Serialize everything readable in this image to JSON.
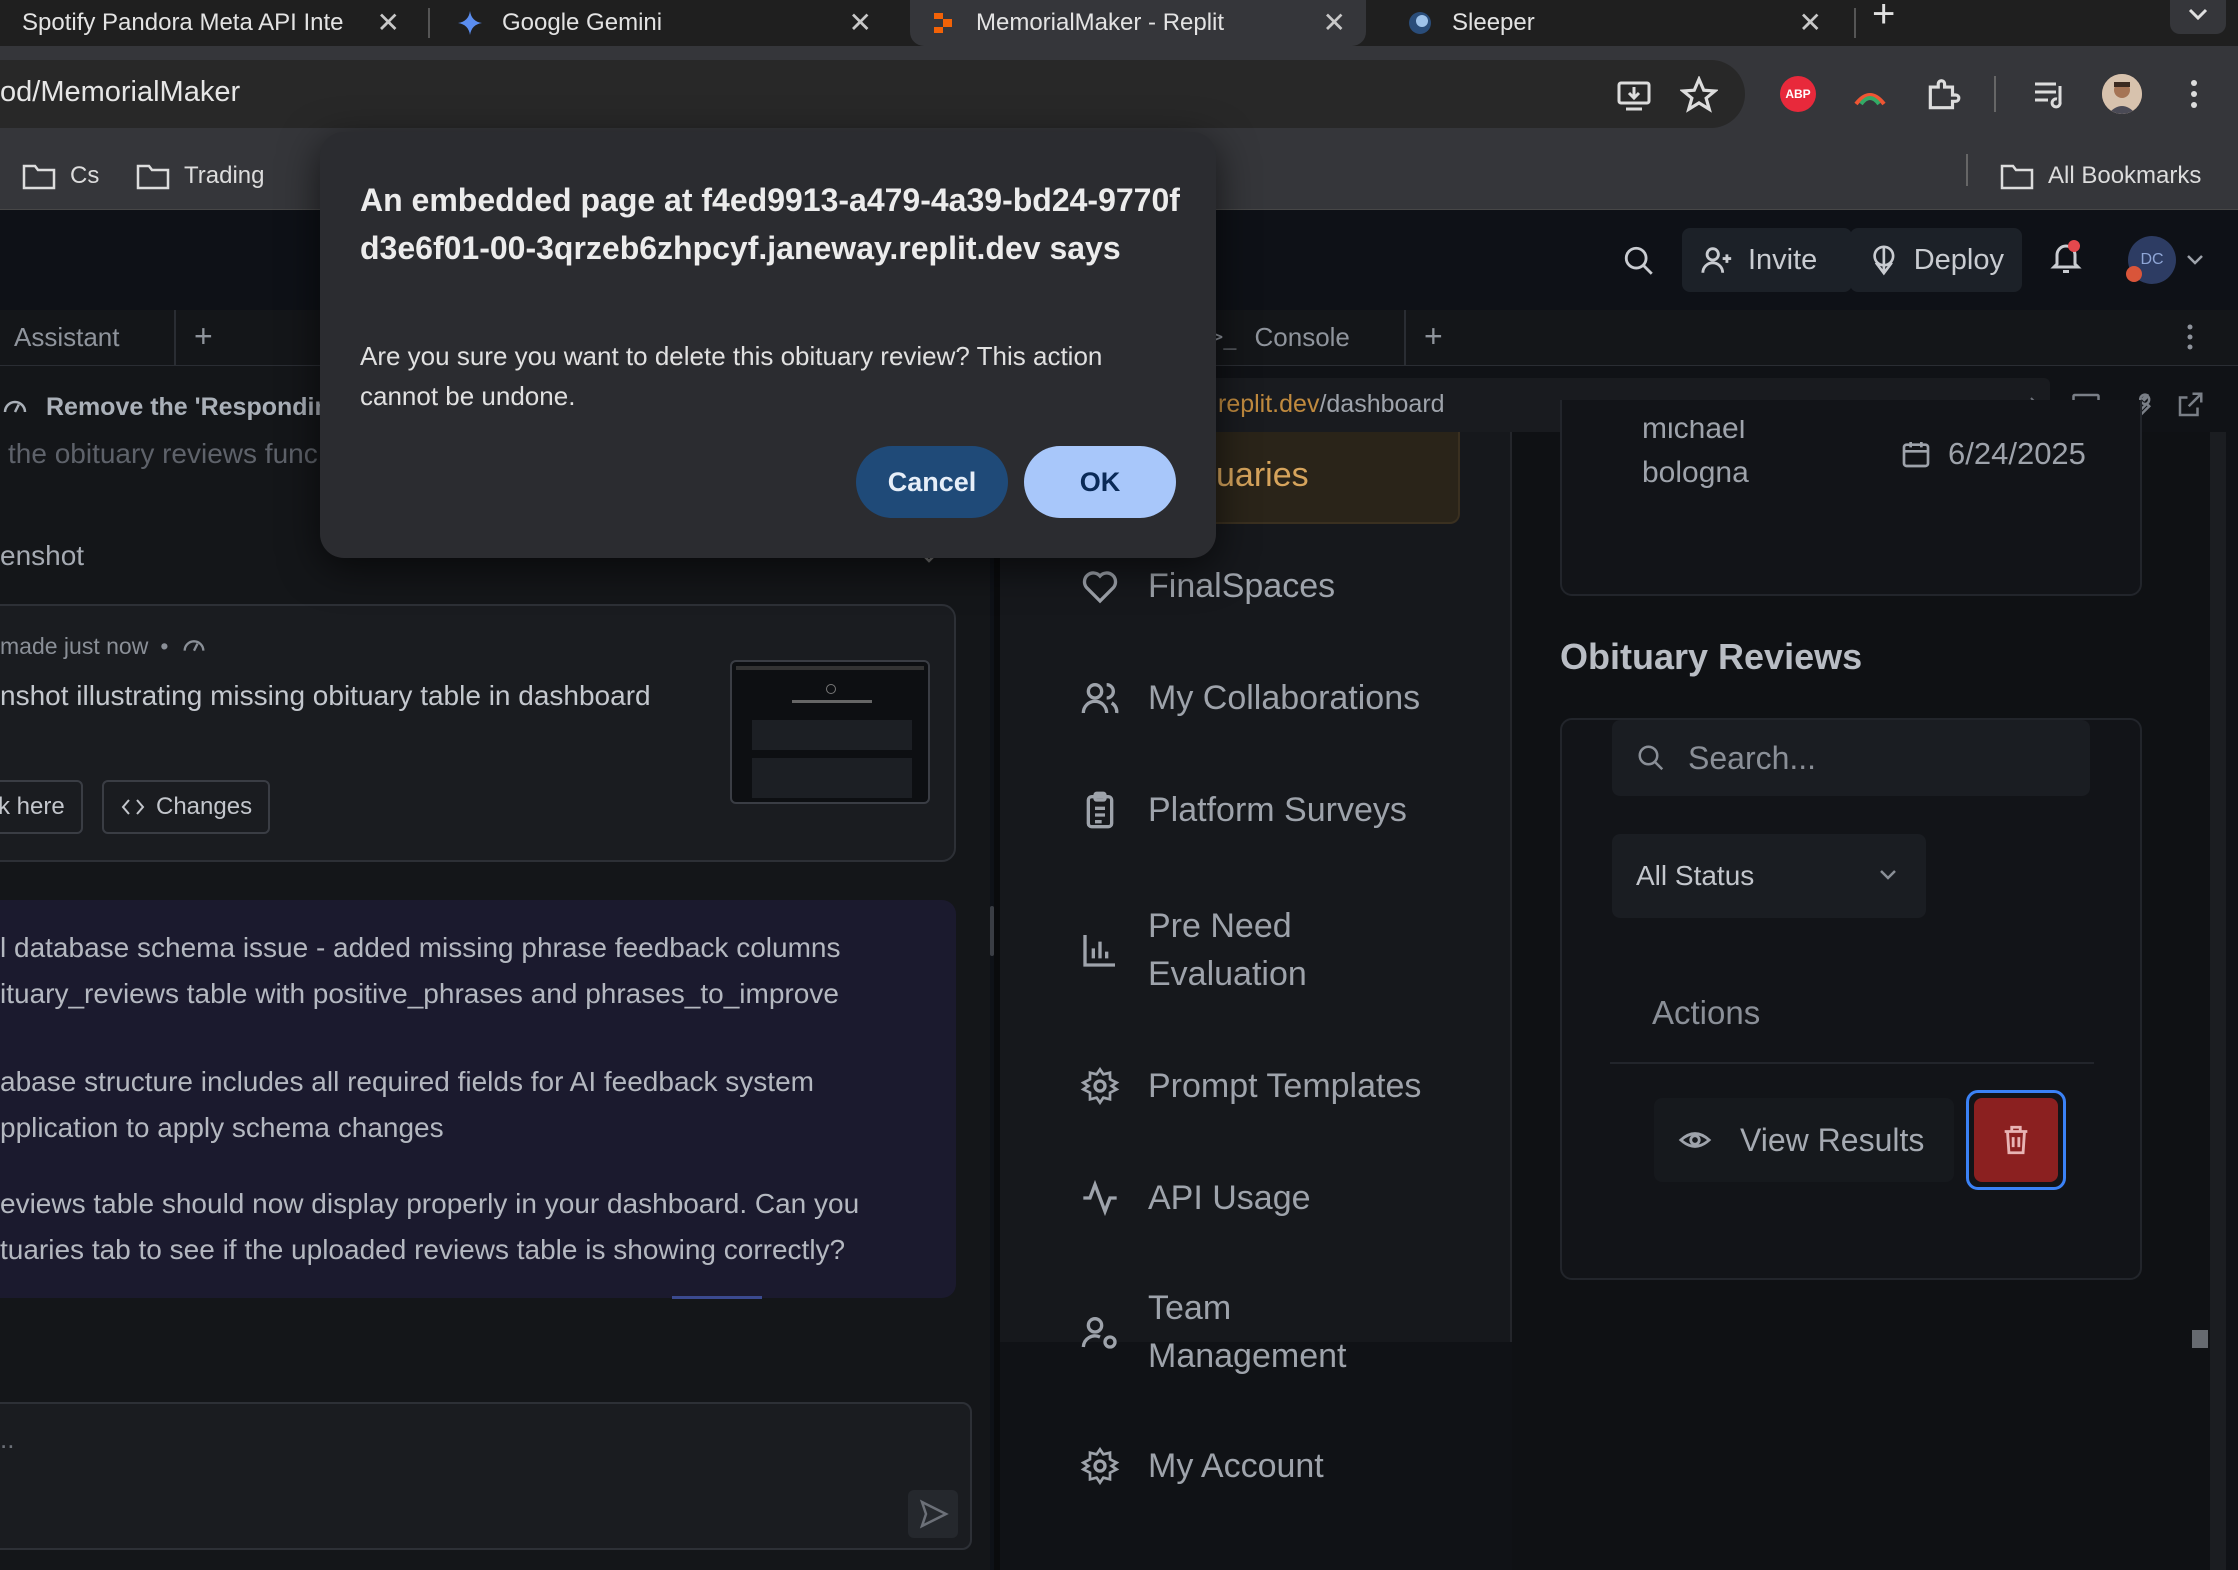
{
  "browser": {
    "tabs": [
      {
        "title": "Spotify Pandora Meta API Inte",
        "active": false
      },
      {
        "title": "Google Gemini",
        "active": false
      },
      {
        "title": "MemorialMaker - Replit",
        "active": true
      },
      {
        "title": "Sleeper",
        "active": false
      }
    ],
    "url": "od/MemorialMaker",
    "bookmarks": [
      "Cs",
      "Trading"
    ],
    "all_bookmarks": "All Bookmarks",
    "abp_badge": "ABP"
  },
  "replit": {
    "invite": "Invite",
    "deploy": "Deploy",
    "avatar_initials": "DC",
    "left_tab": "Assistant",
    "right_tab": "Console",
    "webview_url_host": "replit.dev",
    "webview_url_path": "/dashboard"
  },
  "chat": {
    "checkpoint_text": "Remove the 'Responding",
    "faded_line": "the obituary reviews func",
    "screenshot_header": "enshot",
    "made_line": "made just now",
    "screenshot_caption": "nshot illustrating missing obituary table in dashboard",
    "click_here": "k here",
    "changes": "Changes",
    "messages": [
      "l database schema issue - added missing phrase feedback columns",
      "ituary_reviews table with positive_phrases and phrases_to_improve",
      "abase structure includes all required fields for AI feedback system",
      "pplication to apply schema changes",
      "eviews table should now display properly in your dashboard. Can you",
      "tuaries tab to see if the uploaded reviews table is showing correctly?"
    ],
    "input_placeholder": ".."
  },
  "sidebar": {
    "active_partial": "uaries",
    "items": [
      {
        "label": "FinalSpaces",
        "icon": "heart-icon"
      },
      {
        "label": "My Collaborations",
        "icon": "users-icon"
      },
      {
        "label": "Platform Surveys",
        "icon": "clipboard-icon"
      },
      {
        "label": "Pre Need Evaluation",
        "icon": "bar-chart-icon"
      },
      {
        "label": "Prompt Templates",
        "icon": "gear-icon"
      },
      {
        "label": "API Usage",
        "icon": "activity-icon"
      },
      {
        "label": "Team Management",
        "icon": "user-cog-icon"
      },
      {
        "label": "My Account",
        "icon": "settings-icon"
      }
    ]
  },
  "dashboard": {
    "card_name_partial": "michael",
    "card_name": "bologna",
    "card_date": "6/24/2025",
    "section_title": "Obituary Reviews",
    "search_placeholder": "Search...",
    "status_filter": "All Status",
    "actions_header": "Actions",
    "view_results": "View Results"
  },
  "dialog": {
    "title": "An embedded page at f4ed9913-a479-4a39-bd24-9770fd3e6f01-00-3qrzeb6zhpcyf.janeway.replit.dev says",
    "message": "Are you sure you want to delete this obituary review? This action cannot be undone.",
    "cancel": "Cancel",
    "ok": "OK"
  },
  "colors": {
    "dialog_bg": "#2b2c30",
    "cancel_bg": "#1f4a78",
    "ok_bg": "#a8c7fa",
    "delete_bg": "#8b2020",
    "delete_ring": "#3b82f6",
    "active_sidebar": "#2a2419"
  }
}
